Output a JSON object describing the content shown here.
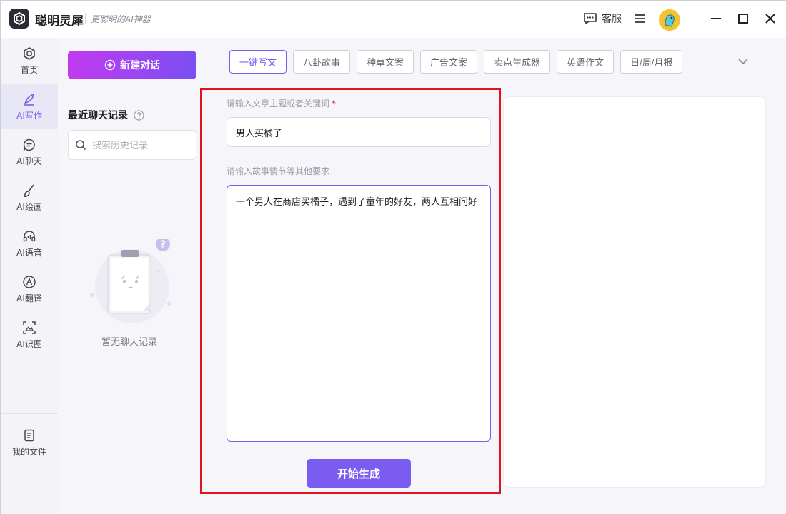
{
  "app": {
    "name": "聪明灵犀",
    "slogan": "更聪明的AI神器"
  },
  "titlebar": {
    "service_label": "客服"
  },
  "nav": {
    "items": [
      {
        "label": "首页",
        "icon": "home-icon"
      },
      {
        "label": "AI写作",
        "icon": "pen-icon"
      },
      {
        "label": "AI聊天",
        "icon": "chat-icon"
      },
      {
        "label": "AI绘画",
        "icon": "brush-icon"
      },
      {
        "label": "AI语音",
        "icon": "headset-icon"
      },
      {
        "label": "AI翻译",
        "icon": "translate-icon"
      },
      {
        "label": "AI识图",
        "icon": "scan-image-icon"
      }
    ],
    "files_label": "我的文件"
  },
  "history": {
    "new_chat_label": "新建对话",
    "recent_title": "最近聊天记录",
    "search_placeholder": "搜索历史记录",
    "empty_text": "暂无聊天记录"
  },
  "tabs": [
    {
      "label": "一键写文",
      "active": true
    },
    {
      "label": "八卦故事",
      "active": false
    },
    {
      "label": "种草文案",
      "active": false
    },
    {
      "label": "广告文案",
      "active": false
    },
    {
      "label": "卖点生成器",
      "active": false
    },
    {
      "label": "英语作文",
      "active": false
    },
    {
      "label": "日/周/月报",
      "active": false
    }
  ],
  "form": {
    "topic_label": "请输入文章主题或者关键词",
    "required_mark": "*",
    "topic_value": "男人买橘子",
    "requirements_label": "请输入故事情节等其他要求",
    "requirements_value": "一个男人在商店买橘子，遇到了童年的好友，两人互相问好",
    "generate_label": "开始生成"
  },
  "colors": {
    "accent": "#7b5cf0",
    "gradient_start": "#c23af0",
    "gradient_end": "#7a4ff2",
    "highlight": "#e0141e"
  }
}
